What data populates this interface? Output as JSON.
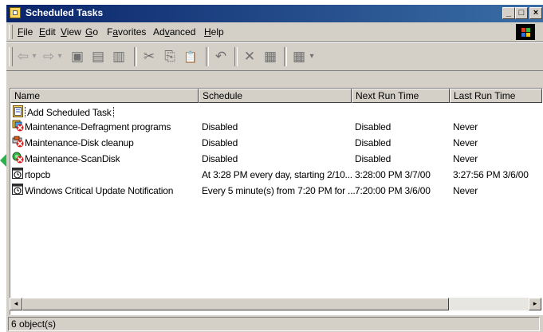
{
  "window": {
    "title": "Scheduled Tasks"
  },
  "caption_buttons": {
    "minimize": "_",
    "maximize": "□",
    "close": "×"
  },
  "menu": [
    {
      "pre": "",
      "u": "F",
      "post": "ile"
    },
    {
      "pre": "",
      "u": "E",
      "post": "dit"
    },
    {
      "pre": "",
      "u": "V",
      "post": "iew"
    },
    {
      "pre": "",
      "u": "G",
      "post": "o"
    },
    {
      "pre": "F",
      "u": "a",
      "post": "vorites"
    },
    {
      "pre": "Ad",
      "u": "v",
      "post": "anced"
    },
    {
      "pre": "",
      "u": "H",
      "post": "elp"
    }
  ],
  "toolbar": {
    "back": "⇦",
    "back_arrow": "▾",
    "forward": "⇨",
    "forward_arrow": "▾",
    "up": "▣",
    "move_to": "▤",
    "copy_to": "▥",
    "cut": "✂",
    "copy": "⎘",
    "paste": "📋",
    "undo": "↶",
    "delete": "✕",
    "properties": "▦",
    "views": "▦",
    "views_arrow": "▾"
  },
  "columns": [
    "Name",
    "Schedule",
    "Next Run Time",
    "Last Run Time"
  ],
  "rows": [
    {
      "icon": "add-task-icon",
      "name": "Add Scheduled Task",
      "schedule": "",
      "next": "",
      "last": ""
    },
    {
      "icon": "task-disabled-icon",
      "name": "Maintenance-Defragment programs",
      "schedule": "Disabled",
      "next": "Disabled",
      "last": "Never"
    },
    {
      "icon": "task-disabled-icon",
      "name": "Maintenance-Disk cleanup",
      "schedule": "Disabled",
      "next": "Disabled",
      "last": "Never"
    },
    {
      "icon": "task-disabled-icon",
      "name": "Maintenance-ScanDisk",
      "schedule": "Disabled",
      "next": "Disabled",
      "last": "Never"
    },
    {
      "icon": "task-clock-icon",
      "name": "rtopcb",
      "schedule": "At 3:28 PM every day, starting 2/10...",
      "next": "3:28:00 PM  3/7/00",
      "last": "3:27:56 PM  3/6/00"
    },
    {
      "icon": "task-clock-icon",
      "name": "Windows Critical Update Notification",
      "schedule": "Every 5 minute(s) from 7:20 PM for ...",
      "next": "7:20:00 PM  3/6/00",
      "last": "Never"
    }
  ],
  "scrollbar": {
    "left": "◂",
    "right": "▸"
  },
  "status": {
    "text": "6 object(s)"
  },
  "colors": {
    "titlebar_start": "#0a246a",
    "titlebar_end": "#3a6ea5",
    "face": "#d4d0c8",
    "disabled_red": "#d42020",
    "arrow_green": "#2bb24c"
  }
}
